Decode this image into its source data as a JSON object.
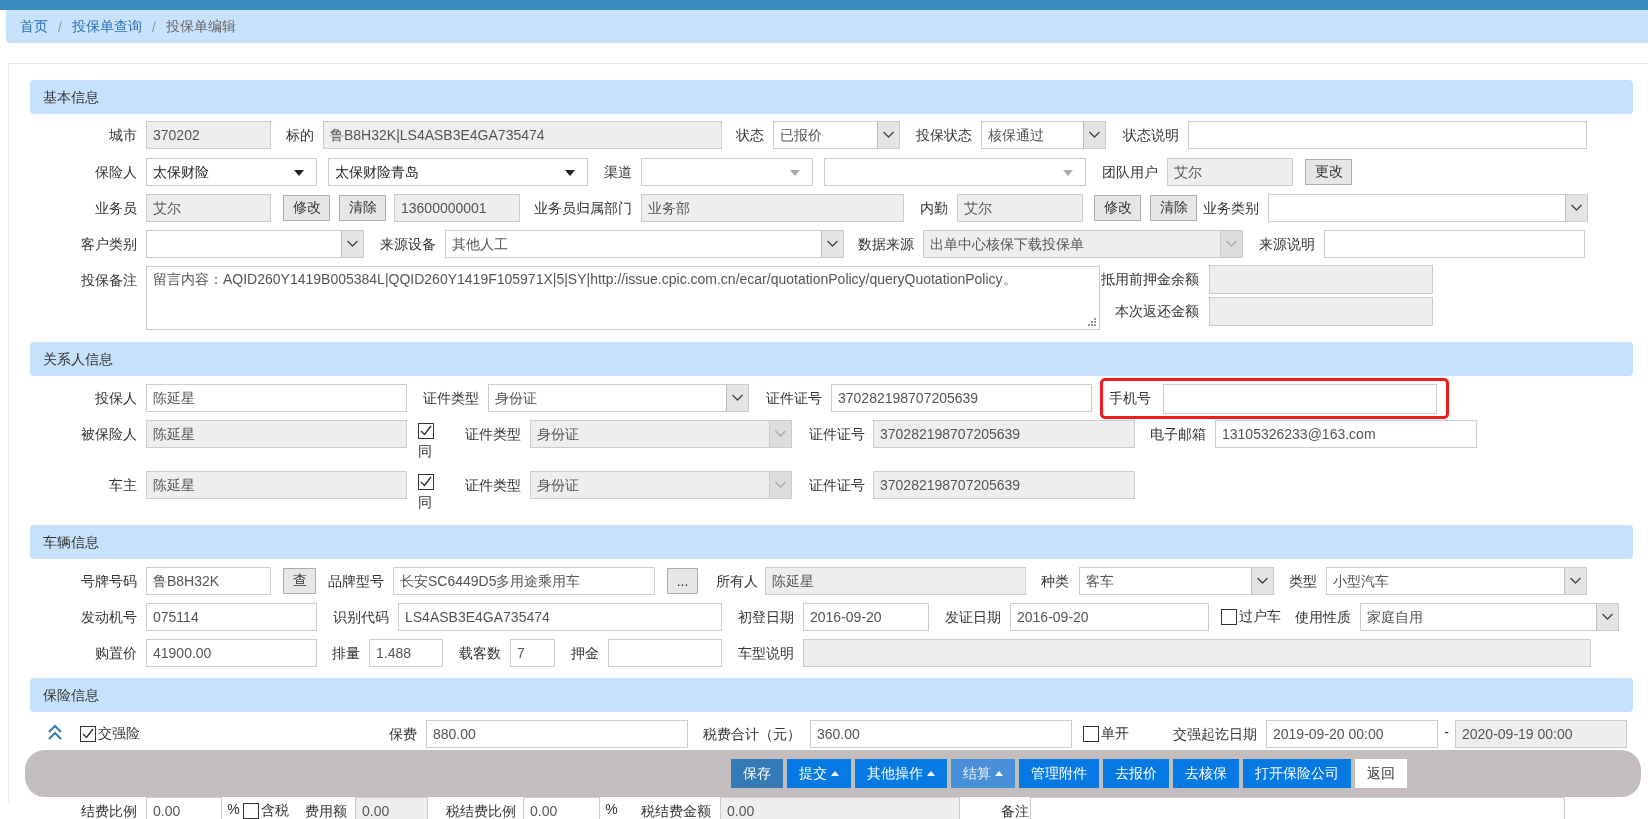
{
  "breadcrumb": [
    {
      "kind": "link",
      "text": "首页"
    },
    {
      "kind": "separator",
      "text": "/"
    },
    {
      "kind": "link",
      "text": "投保单查询"
    },
    {
      "kind": "separator",
      "text": "/"
    },
    {
      "kind": "current",
      "text": "投保单编辑"
    }
  ],
  "sections": [
    {
      "title": "基本信息",
      "rows": [
        {
          "fields": [
            {
              "kind": "label",
              "text": "城市"
            },
            {
              "kind": "input",
              "value": "370202",
              "disabled": true
            },
            {
              "kind": "label",
              "text": "标的"
            },
            {
              "kind": "input",
              "value": "鲁B8H32K|LS4ASB3E4GA735474",
              "disabled": true
            },
            {
              "kind": "label",
              "text": "状态"
            },
            {
              "kind": "select",
              "value": "已报价",
              "disabled": false
            },
            {
              "kind": "label",
              "text": "投保状态"
            },
            {
              "kind": "select",
              "value": "核保通过",
              "disabled": false
            },
            {
              "kind": "label",
              "text": "状态说明"
            },
            {
              "kind": "input",
              "disabled": false
            }
          ]
        },
        {
          "fields": [
            {
              "kind": "label",
              "text": "保险人"
            },
            {
              "kind": "dropdown",
              "value": "太保财险"
            },
            {
              "kind": "dropdown",
              "value": "太保财险青岛"
            },
            {
              "kind": "label",
              "text": "渠道"
            },
            {
              "kind": "dropdown"
            },
            {
              "kind": "dropdown"
            },
            {
              "kind": "label",
              "text": "团队用户"
            },
            {
              "kind": "input",
              "value": "艾尔",
              "disabled": true
            },
            {
              "kind": "button",
              "text": "更改"
            }
          ]
        },
        {
          "fields": [
            {
              "kind": "label",
              "text": "业务员"
            },
            {
              "kind": "input",
              "value": "艾尔",
              "disabled": true
            },
            {
              "kind": "button",
              "text": "修改"
            },
            {
              "kind": "button",
              "text": "清除"
            },
            {
              "kind": "input",
              "value": "13600000001",
              "disabled": true
            },
            {
              "kind": "label",
              "text": "业务员归属部门"
            },
            {
              "kind": "input",
              "value": "业务部",
              "disabled": true
            },
            {
              "kind": "label",
              "text": "内勤"
            },
            {
              "kind": "input",
              "value": "艾尔",
              "disabled": true
            },
            {
              "kind": "button",
              "text": "修改"
            },
            {
              "kind": "button",
              "text": "清除"
            },
            {
              "kind": "label",
              "text": "业务类别"
            },
            {
              "kind": "select",
              "disabled": false
            }
          ]
        },
        {
          "fields": [
            {
              "kind": "label",
              "text": "客户类别"
            },
            {
              "kind": "select",
              "disabled": false
            },
            {
              "kind": "label",
              "text": "来源设备"
            },
            {
              "kind": "select",
              "value": "其他人工",
              "disabled": false
            },
            {
              "kind": "label",
              "text": "数据来源"
            },
            {
              "kind": "select",
              "value": "出单中心核保下载投保单",
              "disabled": true
            },
            {
              "kind": "label",
              "text": "来源说明"
            },
            {
              "kind": "input",
              "disabled": false
            }
          ]
        },
        {
          "fields": [
            {
              "kind": "label",
              "text": "投保备注"
            },
            {
              "kind": "textarea",
              "value": "留言内容：AQID260Y1419B005384L|QQID260Y1419F105971X|5|SY|http://issue.cpic.com.cn/ecar/quotationPolicy/queryQuotationPolicy。"
            },
            {
              "kind": "stack",
              "rows": [
                {
                  "label": "抵用前押金余额",
                  "disabled": true
                },
                {
                  "label": "本次返还金额",
                  "disabled": true
                }
              ]
            }
          ]
        }
      ]
    },
    {
      "title": "关系人信息",
      "rows": [
        {
          "fields": [
            {
              "kind": "label",
              "text": "投保人"
            },
            {
              "kind": "input",
              "value": "陈延星",
              "disabled": false
            },
            {
              "kind": "label",
              "text": "证件类型"
            },
            {
              "kind": "select",
              "value": "身份证",
              "disabled": false
            },
            {
              "kind": "label",
              "text": "证件证号"
            },
            {
              "kind": "input",
              "value": "370282198707205639",
              "disabled": false
            },
            {
              "kind": "group",
              "highlighted": true,
              "label": "手机号",
              "disabled": false
            }
          ]
        },
        {
          "fields": [
            {
              "kind": "label",
              "text": "被保险人"
            },
            {
              "kind": "input",
              "value": "陈延星",
              "disabled": true
            },
            {
              "kind": "checkbelow",
              "text": "同",
              "checked": true
            },
            {
              "kind": "label",
              "text": "证件类型"
            },
            {
              "kind": "select",
              "value": "身份证",
              "disabled": true
            },
            {
              "kind": "label",
              "text": "证件证号"
            },
            {
              "kind": "input",
              "value": "370282198707205639",
              "disabled": true
            },
            {
              "kind": "label",
              "text": "电子邮箱"
            },
            {
              "kind": "input",
              "value": "13105326233@163.com",
              "disabled": false
            }
          ]
        },
        {
          "fields": [
            {
              "kind": "label",
              "text": "车主"
            },
            {
              "kind": "input",
              "value": "陈延星",
              "disabled": true
            },
            {
              "kind": "checkbelow",
              "text": "同",
              "checked": true
            },
            {
              "kind": "label",
              "text": "证件类型"
            },
            {
              "kind": "select",
              "value": "身份证",
              "disabled": true
            },
            {
              "kind": "label",
              "text": "证件证号"
            },
            {
              "kind": "input",
              "value": "370282198707205639",
              "disabled": true
            }
          ]
        }
      ]
    },
    {
      "title": "车辆信息",
      "rows": [
        {
          "fields": [
            {
              "kind": "label",
              "text": "号牌号码"
            },
            {
              "kind": "input",
              "value": "鲁B8H32K",
              "disabled": false
            },
            {
              "kind": "button",
              "text": "查"
            },
            {
              "kind": "label",
              "text": "品牌型号"
            },
            {
              "kind": "input",
              "value": "长安SC6449D5多用途乘用车",
              "disabled": false
            },
            {
              "kind": "button",
              "text": "..."
            },
            {
              "kind": "label",
              "text": "所有人"
            },
            {
              "kind": "input",
              "value": "陈延星",
              "disabled": true
            },
            {
              "kind": "label",
              "text": "种类"
            },
            {
              "kind": "select",
              "value": "客车",
              "disabled": false
            },
            {
              "kind": "label",
              "text": "类型"
            },
            {
              "kind": "select",
              "value": "小型汽车",
              "disabled": false
            }
          ]
        },
        {
          "fields": [
            {
              "kind": "label",
              "text": "发动机号"
            },
            {
              "kind": "input",
              "value": "075114",
              "disabled": false
            },
            {
              "kind": "label",
              "text": "识别代码"
            },
            {
              "kind": "input",
              "value": "LS4ASB3E4GA735474",
              "disabled": false
            },
            {
              "kind": "label",
              "text": "初登日期"
            },
            {
              "kind": "input",
              "value": "2016-09-20",
              "disabled": false
            },
            {
              "kind": "label",
              "text": "发证日期"
            },
            {
              "kind": "input",
              "value": "2016-09-20",
              "disabled": false
            },
            {
              "kind": "checkbox",
              "text": "过户车",
              "checked": false
            },
            {
              "kind": "label",
              "text": "使用性质"
            },
            {
              "kind": "select",
              "value": "家庭自用",
              "disabled": false
            }
          ]
        },
        {
          "fields": [
            {
              "kind": "label",
              "text": "购置价"
            },
            {
              "kind": "input",
              "value": "41900.00",
              "disabled": false
            },
            {
              "kind": "label",
              "text": "排量"
            },
            {
              "kind": "input",
              "value": "1.488",
              "disabled": false
            },
            {
              "kind": "label",
              "text": "载客数"
            },
            {
              "kind": "input",
              "value": "7",
              "disabled": false
            },
            {
              "kind": "label",
              "text": "押金"
            },
            {
              "kind": "input",
              "disabled": false
            },
            {
              "kind": "label",
              "text": "车型说明"
            },
            {
              "kind": "input",
              "disabled": true
            }
          ]
        }
      ]
    },
    {
      "title": "保险信息",
      "rows": [
        {
          "fields": [
            {
              "kind": "collapse"
            },
            {
              "kind": "checkbox",
              "text": "交强险",
              "checked": true
            },
            {
              "kind": "label",
              "text": "保费"
            },
            {
              "kind": "input",
              "value": "880.00",
              "disabled": false
            },
            {
              "kind": "label",
              "text": "税费合计（元）"
            },
            {
              "kind": "input",
              "value": "360.00",
              "disabled": false
            },
            {
              "kind": "checkbox",
              "text": "单开",
              "checked": false
            },
            {
              "kind": "label",
              "text": "交强起讫日期"
            },
            {
              "kind": "input",
              "value": "2019-09-20 00:00",
              "disabled": false
            },
            {
              "kind": "text",
              "text": "-"
            },
            {
              "kind": "input",
              "value": "2020-09-19 00:00",
              "disabled": true
            }
          ]
        },
        {
          "fields": [
            {
              "kind": "label",
              "text": "结费比例"
            },
            {
              "kind": "input",
              "value": "0.00",
              "disabled": false
            },
            {
              "kind": "text",
              "text": "%"
            },
            {
              "kind": "checkbox",
              "text": "含税",
              "checked": false
            },
            {
              "kind": "label",
              "text": "费用额"
            },
            {
              "kind": "input",
              "value": "0.00",
              "disabled": true
            },
            {
              "kind": "label",
              "text": "税结费比例"
            },
            {
              "kind": "input",
              "value": "0.00",
              "disabled": false
            },
            {
              "kind": "text",
              "text": "%"
            },
            {
              "kind": "label",
              "text": "税结费金额"
            },
            {
              "kind": "input",
              "value": "0.00",
              "disabled": true
            },
            {
              "kind": "label",
              "text": "备注"
            },
            {
              "kind": "input",
              "disabled": false
            }
          ]
        }
      ]
    }
  ],
  "actions": [
    {
      "text": "保存",
      "kind": "save",
      "menu": false
    },
    {
      "text": "提交",
      "kind": "primary",
      "menu": true
    },
    {
      "text": "其他操作",
      "kind": "primary",
      "menu": true
    },
    {
      "text": "结算",
      "kind": "muted",
      "menu": true
    },
    {
      "text": "管理附件",
      "kind": "primary",
      "menu": false
    },
    {
      "text": "去报价",
      "kind": "primary",
      "menu": false
    },
    {
      "text": "去核保",
      "kind": "primary",
      "menu": false
    },
    {
      "text": "打开保险公司",
      "kind": "primary",
      "menu": false
    },
    {
      "text": "返回",
      "kind": "plain",
      "menu": false
    }
  ]
}
